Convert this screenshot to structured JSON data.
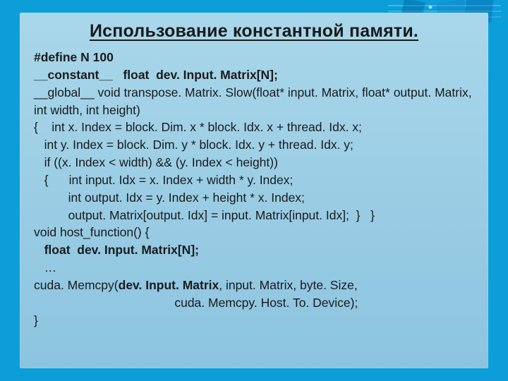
{
  "title": "Использование константной памяти.",
  "code": {
    "l1a": "#define N 100",
    "l2a": "__constant__   float  dev. Input. Matrix[N];",
    "l3": "__global__ void transpose. Matrix. Slow(float* input. Matrix, float* output. Matrix,",
    "l4": "int width, int height)",
    "l5": "{    int x. Index = block. Dim. x * block. Idx. x + thread. Idx. x;",
    "l6": "   int y. Index = block. Dim. y * block. Idx. y + thread. Idx. y;",
    "l7": "   if ((x. Index < width) && (y. Index < height))",
    "l8": "   {      int input. Idx = x. Index + width * y. Index;",
    "l9": "          int output. Idx = y. Index + height * x. Index;",
    "l10": "          output. Matrix[output. Idx] = input. Matrix[input. Idx];  }   }",
    "l11": "void host_function() {",
    "l12a": "   float  dev. Input. Matrix[N];",
    "l13": "   …",
    "l14a": "cuda. Memcpy(",
    "l14b": "dev. Input. Matrix",
    "l14c": ", input. Matrix, byte. Size,",
    "l15": "                                         cuda. Memcpy. Host. To. Device);",
    "l16": "}"
  }
}
